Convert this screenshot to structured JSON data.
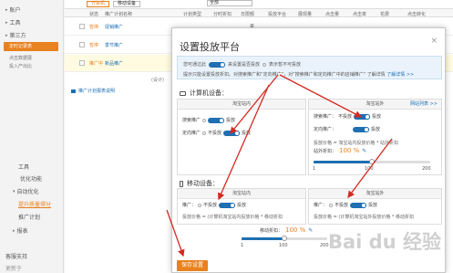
{
  "sidebar": {
    "top_items": [
      "账户",
      "工具",
      "第三方"
    ],
    "highlight": "定时记录表",
    "sub_items": [
      "点击数据展",
      "投入产出比"
    ],
    "lower_items": [
      "工具",
      "优化功能",
      "自动优化",
      "提升质量得分",
      "推广计划",
      "报表"
    ],
    "bottom_items": [
      "客服支持",
      "更新于"
    ]
  },
  "main": {
    "tabs": [
      "计算机",
      "移动设备"
    ],
    "select": "全部",
    "columns": [
      "状态",
      "推广计划名称",
      "计划类型",
      "分时折扣",
      "日限额",
      "投放平台",
      "展现量",
      "点击量",
      "点击率",
      "花费",
      "点击转化"
    ],
    "rows": [
      {
        "status": "暂停",
        "name": "促销推广",
        "yn": "否"
      },
      {
        "status": "暂停",
        "name": "季节推广",
        "yn": "否"
      },
      {
        "status": "推广中",
        "name": "新品推广",
        "yn": "否"
      }
    ],
    "edit_note": "(设计)",
    "bottom_link": "推广计划报表说明"
  },
  "modal": {
    "title": "设置投放平台",
    "close": "×",
    "notice_1_a": "您可通过此",
    "notice_1_b": "来设置是否投放",
    "notice_1_c": "表示暂不可投放",
    "notice_2": "提示只能设置投放折扣。对搜索推广和“定向推广”，对”搜索推广和定向推广中的店铺推广\" 了解详情",
    "notice_2_link": "了解详情 >>",
    "pc_section": "计算机设备：",
    "pc_left_head": "淘宝站内",
    "pc_right_head": "淘宝站外",
    "pc_right_link": "网站列表 >>",
    "pc_left_row1": "搜索推广",
    "pc_left_row1_state": "投放",
    "pc_left_row2": "定向推广",
    "pc_left_row2_off": "不投放",
    "pc_left_row2_state": "投放",
    "pc_right_row1": "搜索推广：",
    "pc_right_row1_off": "不投放",
    "pc_right_row1_state": "投放",
    "pc_right_row2": "定向推广：",
    "pc_right_row2_state": "投放",
    "pc_right_price_note": "投放价格 = 淘宝站内投放价格 * 站外折扣",
    "pc_right_discount_label": "站外折扣：",
    "pc_right_discount": "100 %",
    "pc_slider_min": "1",
    "pc_slider_mid": "100",
    "pc_slider_max": "200",
    "mobile_section": "移动设备：",
    "mobile_left_head": "淘宝站内",
    "mobile_right_head": "淘宝站外",
    "mobile_left_row": "推广：",
    "mobile_left_off": "不投放",
    "mobile_left_state": "投放",
    "mobile_left_note": "投放价格 = (计算机淘宝站内投放价格 * 移动折扣",
    "mobile_right_row": "推广：",
    "mobile_right_off": "不投放",
    "mobile_right_state": "投放",
    "mobile_right_note": "投放价格 = (计算机淘宝站外投放价格 * 移动折扣",
    "mobile_discount_label": "移动折扣：",
    "mobile_discount": "100 %",
    "mobile_slider_min": "1",
    "mobile_slider_mid": "100",
    "mobile_slider_max": "200",
    "save": "保存设置"
  },
  "watermark": "Bai du 经验",
  "slider_values": {
    "pc": 0.5,
    "mobile": 0.5
  },
  "colors": {
    "accent": "#e8811f",
    "link": "#1a6fb5",
    "toggle": "#1f6fb2",
    "arrow": "#d42a20"
  }
}
